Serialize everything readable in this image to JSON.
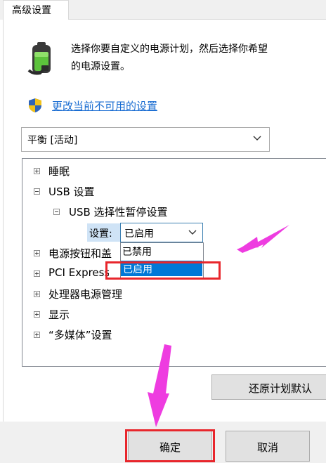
{
  "tab": {
    "label": "高级设置"
  },
  "description": {
    "line1": "选择你要自定义的电源计划，然后选择你希望",
    "line2": "的电源设置。"
  },
  "change_link": "更改当前不可用的设置",
  "plan_select": {
    "value": "平衡 [活动]"
  },
  "tree": {
    "sleep": "睡眠",
    "usb": "USB 设置",
    "usb_selective": "USB 选择性暂停设置",
    "setting_label": "设置:",
    "setting_value": "已启用",
    "power_buttons": "电源按钮和盖",
    "pci": "PCI Express",
    "cpu": "处理器电源管理",
    "display": "显示",
    "multimedia": "“多媒体”设置"
  },
  "dropdown_options": [
    "已禁用",
    "已启用"
  ],
  "buttons": {
    "restore": "还原计划默认",
    "ok": "确定",
    "cancel": "取消"
  },
  "colors": {
    "highlight": "#0078d7",
    "annotation_red": "#e8262c",
    "annotation_arrow": "#ee3ce0",
    "link": "#1a6dd2"
  }
}
